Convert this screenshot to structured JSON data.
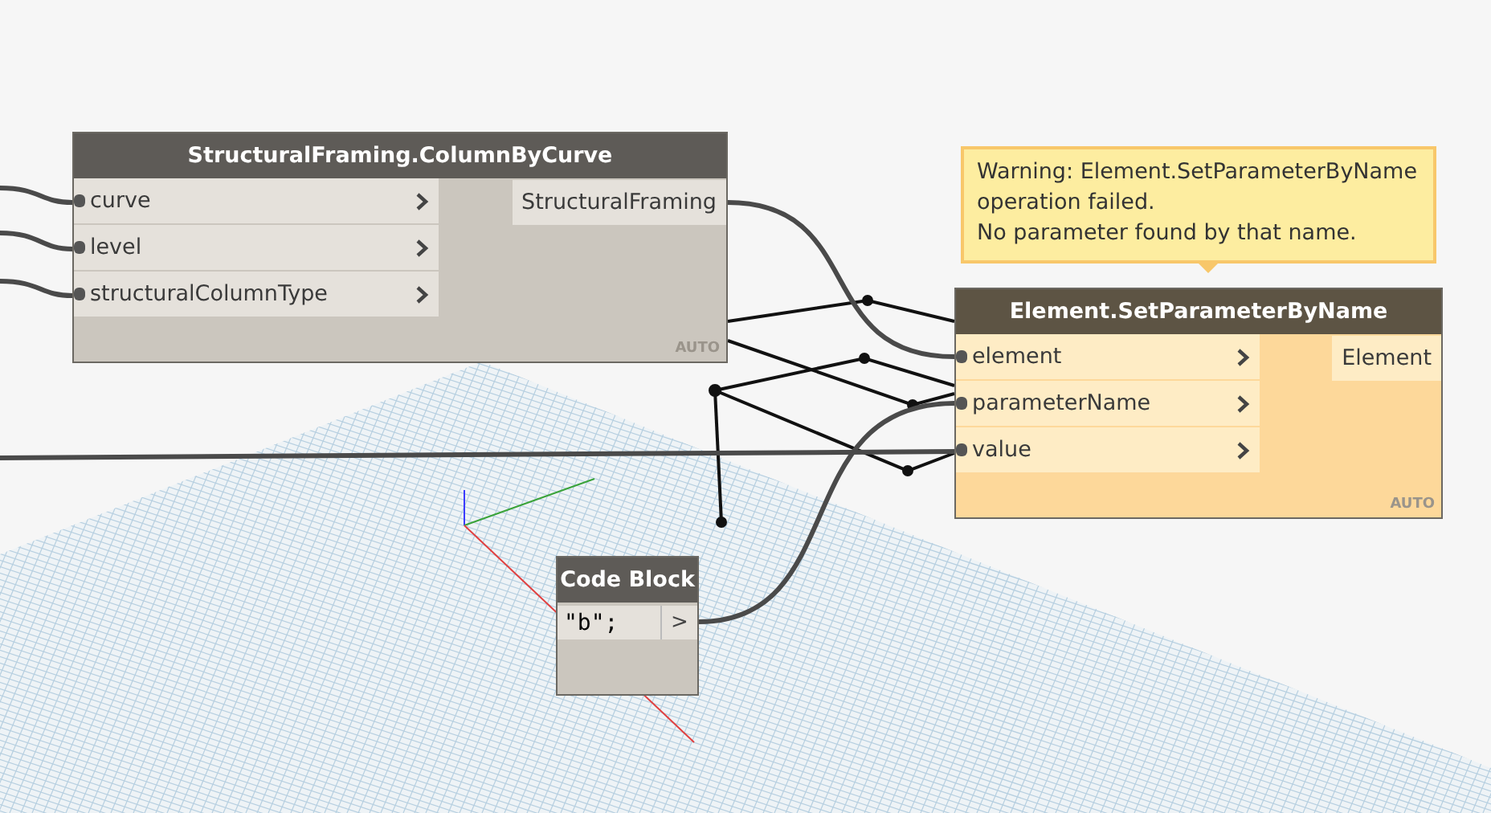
{
  "nodes": [
    {
      "kind": "function",
      "warning": false,
      "title": "StructuralFraming.ColumnByCurve",
      "inputs": [
        "curve",
        "level",
        "structuralColumnType"
      ],
      "outputs": [
        "StructuralFraming"
      ],
      "lacing": "AUTO"
    },
    {
      "kind": "function",
      "warning": true,
      "title": "Element.SetParameterByName",
      "inputs": [
        "element",
        "parameterName",
        "value"
      ],
      "outputs": [
        "Element"
      ],
      "lacing": "AUTO",
      "warning_text": [
        "Warning: Element.SetParameterByName",
        "operation failed.",
        "No parameter found by that name."
      ]
    },
    {
      "kind": "code",
      "warning": false,
      "title": "Code Block",
      "code": "\"b\";",
      "output": ">"
    }
  ]
}
